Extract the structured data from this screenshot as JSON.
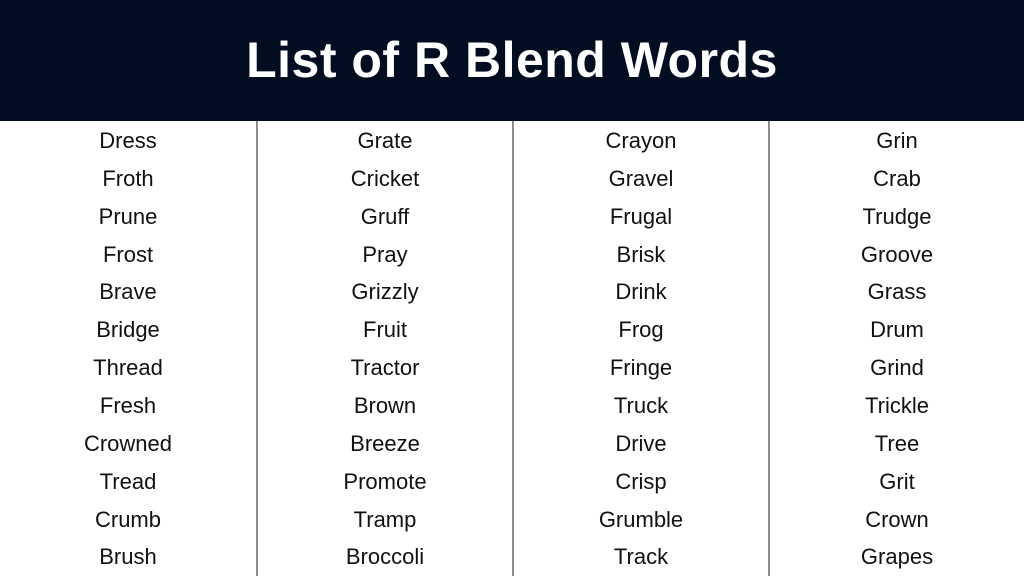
{
  "header": {
    "title": "List of R Blend Words",
    "background_color": "#020d21",
    "text_color": "#ffffff"
  },
  "columns": [
    {
      "words": [
        "Dress",
        "Froth",
        "Prune",
        "Frost",
        "Brave",
        "Bridge",
        "Thread",
        "Fresh",
        "Crowned",
        "Tread",
        "Crumb",
        "Brush"
      ]
    },
    {
      "words": [
        "Grate",
        "Cricket",
        "Gruff",
        "Pray",
        "Grizzly",
        "Fruit",
        "Tractor",
        "Brown",
        "Breeze",
        "Promote",
        "Tramp",
        "Broccoli"
      ]
    },
    {
      "words": [
        "Crayon",
        "Gravel",
        "Frugal",
        "Brisk",
        "Drink",
        "Frog",
        "Fringe",
        "Truck",
        "Drive",
        "Crisp",
        "Grumble",
        "Track"
      ]
    },
    {
      "words": [
        "Grin",
        "Crab",
        "Trudge",
        "Groove",
        "Grass",
        "Drum",
        "Grind",
        "Trickle",
        "Tree",
        "Grit",
        "Crown",
        "Grapes"
      ]
    }
  ]
}
